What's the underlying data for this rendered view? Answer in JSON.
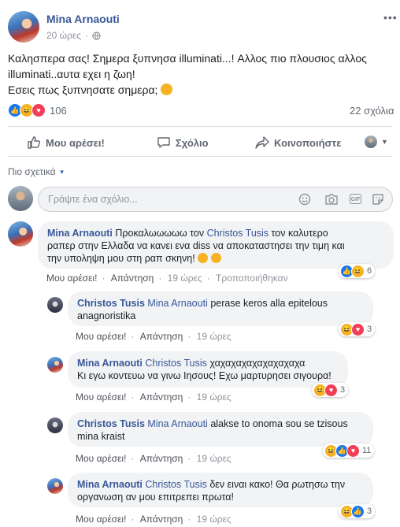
{
  "post": {
    "author": "Mina Arnaouti",
    "time": "20 ώρες",
    "text_line1": "Καλησπερα σας! Σημερα ξυπνησα illuminati...! Αλλος πιο πλουσιος αλλος",
    "text_line2": "illuminati..αυτα εχει η ζωη!",
    "text_line3": "Εσεις πως ξυπνησατε σημερα;",
    "reactions_count": "106",
    "comments_count": "22 σχόλια"
  },
  "actions": {
    "like": "Μου αρέσει!",
    "comment": "Σχόλιο",
    "share": "Κοινοποιήστε"
  },
  "sort": {
    "label": "Πιο σχετικά"
  },
  "composer": {
    "placeholder": "Γράψτε ένα σχόλιο..."
  },
  "comments": [
    {
      "author": "Mina Arnaouti",
      "mention": "Christos Tusis",
      "text_a": "Προκαλωωωωω τον",
      "text_b": "τον καλυτερο",
      "line2": "ραπερ στην Ελλαδα να κανει ενα diss να αποκαταστησει την τιμη και",
      "line3": "την υποληψη μου στη ραπ σκηνη!",
      "like": "Μου αρέσει!",
      "reply": "Απάντηση",
      "time": "19 ώρες",
      "edited": "Τροποποιήθηκαν",
      "react_count": "6"
    },
    {
      "author": "Christos Tusis",
      "mention": "Mina Arnaouti",
      "line1": "perase keros alla epitelous",
      "line2": "anagnoristika",
      "like": "Μου αρέσει!",
      "reply": "Απάντηση",
      "time": "19 ώρες",
      "react_count": "3"
    },
    {
      "author": "Mina Arnaouti",
      "mention": "Christos Tusis",
      "line1": "χαχαχαχαχαχαχαχαχα",
      "line2": "Κι εγω κοντευω να γινω Ιησους! Εχω μαρτυρησει σιγουρα!",
      "like": "Μου αρέσει!",
      "reply": "Απάντηση",
      "time": "19 ώρες",
      "react_count": "3"
    },
    {
      "author": "Christos Tusis",
      "mention": "Mina Arnaouti",
      "line1": "alakse to onoma sou se tzisous",
      "line2": "mina kraist",
      "like": "Μου αρέσει!",
      "reply": "Απάντηση",
      "time": "19 ώρες",
      "react_count": "11"
    },
    {
      "author": "Mina Arnaouti",
      "mention": "Christos Tusis",
      "line1": "δεν ειναι κακο! Θα ρωτησω την",
      "line2": "οργανωση αν μου επιτρεπει πρωτα!",
      "like": "Μου αρέσει!",
      "reply": "Απάντηση",
      "time": "19 ώρες",
      "react_count": "3"
    }
  ],
  "icons": {
    "globe": "globe-icon",
    "more": "more-icon",
    "like": "thumbs-up-icon",
    "comment": "speech-bubble-icon",
    "share": "share-arrow-icon",
    "emoji": "smiley-icon",
    "camera": "camera-icon",
    "gif": "gif-icon",
    "sticker": "sticker-icon"
  },
  "colors": {
    "link": "#385898",
    "meta": "#90949c",
    "bubble": "#f2f3f5",
    "like_blue": "#1877f2",
    "haha_yellow": "#f7b125",
    "love_red": "#f33e58"
  }
}
